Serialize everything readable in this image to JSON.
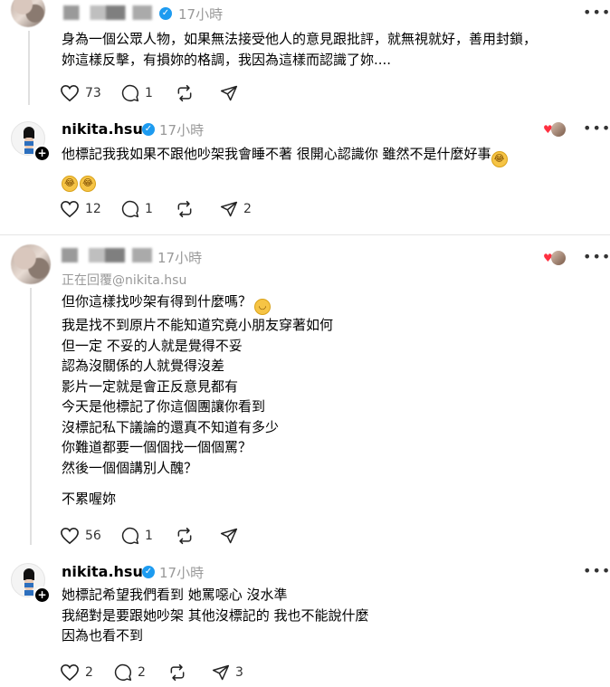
{
  "post1": {
    "time": "17小時",
    "text_lines": [
      "身為一個公眾人物，如果無法接受他人的意見跟批評，就無視就好，善用封鎖，",
      "妳這樣反擊，有損妳的格調，我因為這樣而認識了妳...."
    ],
    "likes": "73",
    "replies": "1",
    "reposts": "",
    "shares": ""
  },
  "reply1": {
    "username": "nikita.hsu",
    "time": "17小時",
    "text_line1": "他標記我我如果不跟他吵架我會睡不著 很開心認識你 雖然不是什麼好事",
    "likes": "12",
    "replies": "1",
    "reposts": "",
    "shares": "2"
  },
  "post2": {
    "time": "17小時",
    "replying_prefix": "正在回覆",
    "replying_handle": "@nikita.hsu",
    "text_lines": [
      "但你這樣找吵架有得到什麼嗎？",
      "我是找不到原片不能知道究竟小朋友穿著如何",
      "但一定 不妥的人就是覺得不妥",
      "認為沒關係的人就覺得沒差",
      "影片一定就是會正反意見都有",
      "今天是他標記了你這個團讓你看到",
      "沒標記私下議論的還真不知道有多少",
      "你難道都要一個個找一個個罵？",
      "然後一個個講別人醜？"
    ],
    "text_last": "不累喔妳",
    "likes": "56",
    "replies": "1",
    "reposts": "",
    "shares": ""
  },
  "reply2": {
    "username": "nikita.hsu",
    "time": "17小時",
    "text_lines": [
      "她標記希望我們看到 她罵噁心 沒水準",
      "我絕對是要跟她吵架 其他沒標記的 我也不能說什麼",
      "因為也看不到"
    ],
    "likes": "2",
    "replies": "2",
    "reposts": "",
    "shares": "3"
  },
  "icons": {
    "like": "heart-icon",
    "reply": "comment-icon",
    "repost": "repost-icon",
    "share": "send-icon",
    "more": "more-icon",
    "verified": "verified-badge-icon",
    "emoji": "rolling-laughing-emoji"
  },
  "colors": {
    "text": "#000000",
    "muted": "#999999",
    "verified": "#1d9bf0",
    "heart": "#ff3040"
  }
}
